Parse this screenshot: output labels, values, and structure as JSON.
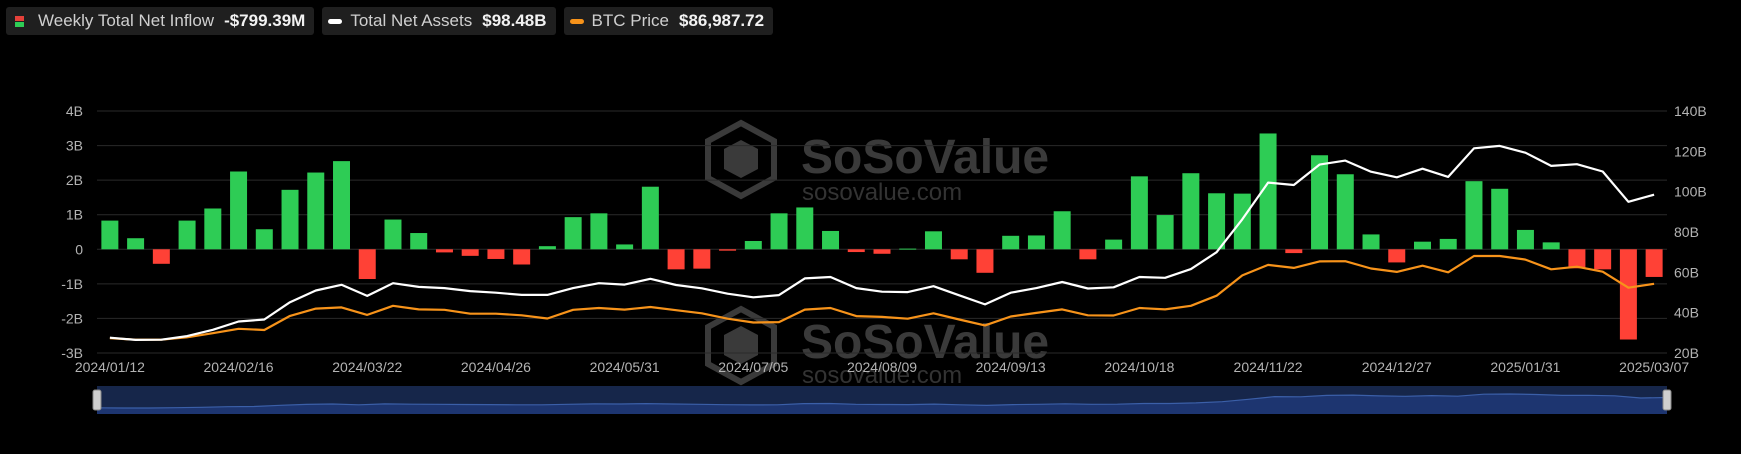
{
  "legend": {
    "inflow": {
      "label": "Weekly Total Net Inflow",
      "value": "-$799.39M"
    },
    "assets": {
      "label": "Total Net Assets",
      "value": "$98.48B"
    },
    "btc": {
      "label": "BTC Price",
      "value": "$86,987.72"
    }
  },
  "watermark": {
    "brand": "SoSoValue",
    "url": "sosovalue.com"
  },
  "colors": {
    "positive": "#2ecc55",
    "negative": "#ff4136",
    "assets_line": "#ffffff",
    "btc_line": "#f7931a",
    "grid": "#2a2a2a",
    "navigator": "#16264a"
  },
  "chart_data": {
    "type": "bar",
    "grid": true,
    "legend_position": "top-left",
    "x_tick_labels": [
      "2024/01/12",
      "2024/02/16",
      "2024/03/22",
      "2024/04/26",
      "2024/05/31",
      "2024/07/05",
      "2024/08/09",
      "2024/09/13",
      "2024/10/18",
      "2024/11/22",
      "2024/12/27",
      "2025/01/31",
      "2025/03/07"
    ],
    "y_left_ticks": [
      "4B",
      "3B",
      "2B",
      "1B",
      "0",
      "-1B",
      "-2B",
      "-3B"
    ],
    "y_left_range": [
      -3,
      4
    ],
    "y_right_ticks": [
      "140B",
      "120B",
      "100B",
      "80B",
      "60B",
      "40B",
      "20B"
    ],
    "y_right_range": [
      20,
      140
    ],
    "series": [
      {
        "name": "Weekly Total Net Inflow",
        "unit": "B USD",
        "type": "bar",
        "values": [
          0.83,
          0.32,
          -0.42,
          0.83,
          1.18,
          2.25,
          0.58,
          1.72,
          2.22,
          2.55,
          -0.86,
          0.86,
          0.47,
          -0.09,
          -0.19,
          -0.28,
          -0.44,
          0.09,
          0.93,
          1.04,
          0.14,
          1.81,
          -0.58,
          -0.56,
          -0.04,
          0.24,
          1.04,
          1.21,
          0.53,
          -0.08,
          -0.13,
          0.02,
          0.52,
          -0.29,
          -0.68,
          0.39,
          0.4,
          1.1,
          -0.29,
          0.28,
          2.11,
          0.99,
          2.2,
          1.62,
          1.61,
          3.35,
          -0.11,
          2.72,
          2.17,
          0.43,
          -0.38,
          0.22,
          0.3,
          1.97,
          1.75,
          0.56,
          0.2,
          -0.55,
          -0.58,
          -2.61,
          -0.8
        ]
      },
      {
        "name": "Total Net Assets",
        "unit": "B USD",
        "type": "line",
        "axis": "right",
        "values": [
          27.6,
          26.5,
          26.6,
          28.4,
          31.5,
          35.6,
          36.6,
          45.2,
          51.0,
          53.8,
          48.3,
          54.6,
          52.8,
          52.2,
          50.7,
          49.9,
          48.8,
          48.8,
          52.2,
          54.6,
          53.9,
          56.8,
          53.7,
          52.1,
          49.4,
          47.6,
          48.7,
          57.0,
          57.7,
          52.2,
          50.4,
          50.2,
          53.1,
          48.6,
          44.1,
          49.9,
          52.2,
          55.2,
          52.0,
          52.6,
          57.7,
          57.3,
          61.6,
          70.0,
          86.3,
          104.5,
          103.3,
          113.4,
          115.4,
          109.9,
          107.1,
          111.4,
          107.3,
          121.5,
          122.7,
          119.3,
          112.8,
          113.6,
          110.0,
          95.0,
          98.5
        ]
      },
      {
        "name": "BTC Price",
        "type": "line",
        "axis": "right",
        "values": [
          27.4,
          26.6,
          26.6,
          27.8,
          29.8,
          32.0,
          31.4,
          38.4,
          42.0,
          42.6,
          38.9,
          43.4,
          41.6,
          41.4,
          39.5,
          39.5,
          38.7,
          37.1,
          41.4,
          42.3,
          41.5,
          42.8,
          41.2,
          39.7,
          37.0,
          35.1,
          35.3,
          41.5,
          42.3,
          38.3,
          37.9,
          37.0,
          39.7,
          36.6,
          33.7,
          38.1,
          39.9,
          41.6,
          38.7,
          38.6,
          42.3,
          41.6,
          43.4,
          48.4,
          58.5,
          63.7,
          62.2,
          65.4,
          65.5,
          61.9,
          60.2,
          63.3,
          60.0,
          68.1,
          68.1,
          66.3,
          61.5,
          62.8,
          60.3,
          52.4,
          54.3
        ]
      }
    ]
  }
}
